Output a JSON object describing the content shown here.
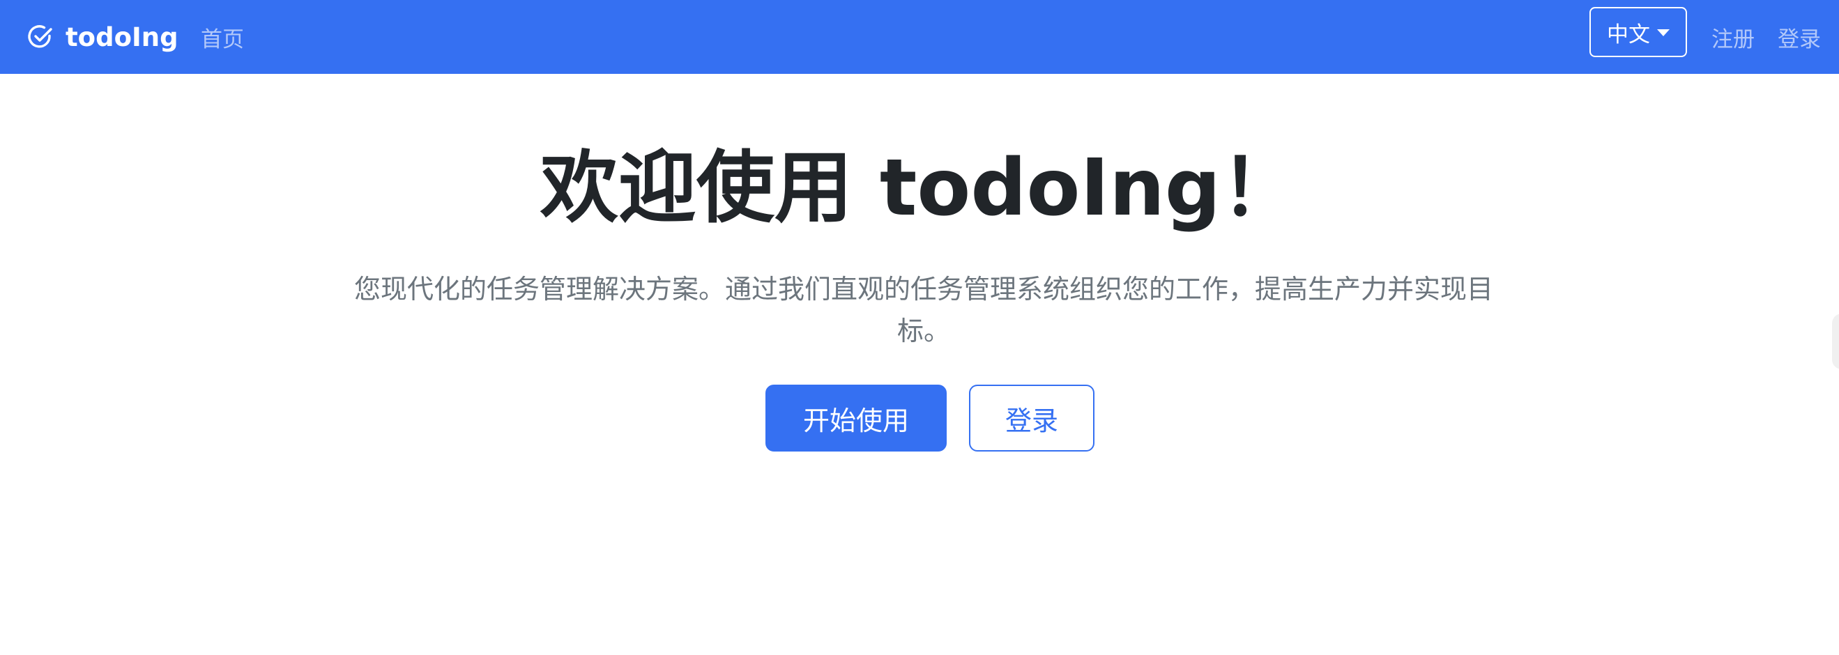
{
  "navbar": {
    "brand_name": "todoIng",
    "brand_icon": "check-circle-icon",
    "home_label": "首页",
    "language_selected": "中文",
    "register_label": "注册",
    "login_label": "登录",
    "background_color": "#3570f2"
  },
  "hero": {
    "title": "欢迎使用 todoIng！",
    "subtitle": "您现代化的任务管理解决方案。通过我们直观的任务管理系统组织您的工作，提高生产力并实现目标。",
    "primary_button_label": "开始使用",
    "secondary_button_label": "登录"
  },
  "colors": {
    "accent": "#3570f2",
    "title_text": "#212529",
    "subtitle_text": "#6c757d"
  }
}
